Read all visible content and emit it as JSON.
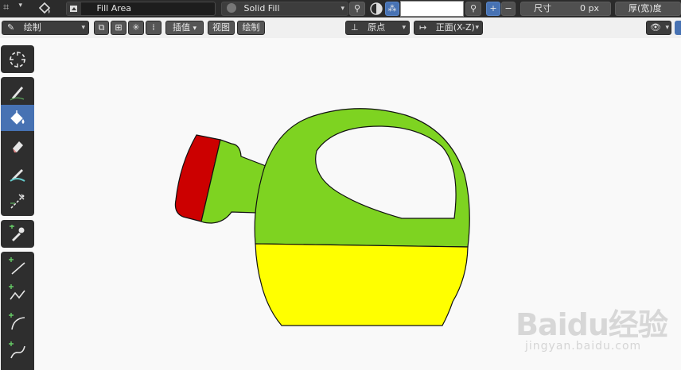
{
  "top_bar": {
    "layer_name": "Fill Area",
    "material_name": "Solid Fill",
    "color_value": "",
    "size_label": "尺寸",
    "size_value": "0 px",
    "thickness_label": "厚(宽)度"
  },
  "tool_header": {
    "mode_label": "绘制",
    "interpolate_label": "插值",
    "view_label": "视图",
    "draw_label": "绘制",
    "origin_label": "原点",
    "orientation_label": "正面(X-Z)"
  },
  "toolbar": {
    "tools": [
      {
        "icon": "cursor-icon"
      },
      {
        "icon": "draw-icon"
      },
      {
        "icon": "fill-icon",
        "active": true
      },
      {
        "icon": "erase-icon"
      },
      {
        "icon": "tint-icon"
      },
      {
        "icon": "cutter-icon"
      },
      {
        "icon": "eyedropper-icon"
      },
      {
        "icon": "line-icon"
      },
      {
        "icon": "polyline-icon"
      },
      {
        "icon": "arc-icon"
      },
      {
        "icon": "curve-icon"
      }
    ]
  },
  "watermark": {
    "brand": "Baidu经验",
    "url": "jingyan.baidu.com"
  },
  "colors": {
    "accent": "#4772b3",
    "can_green": "#7ed321",
    "can_yellow": "#ffff00",
    "can_red": "#cc0000",
    "viewport_bg": "#f9f9f9"
  }
}
